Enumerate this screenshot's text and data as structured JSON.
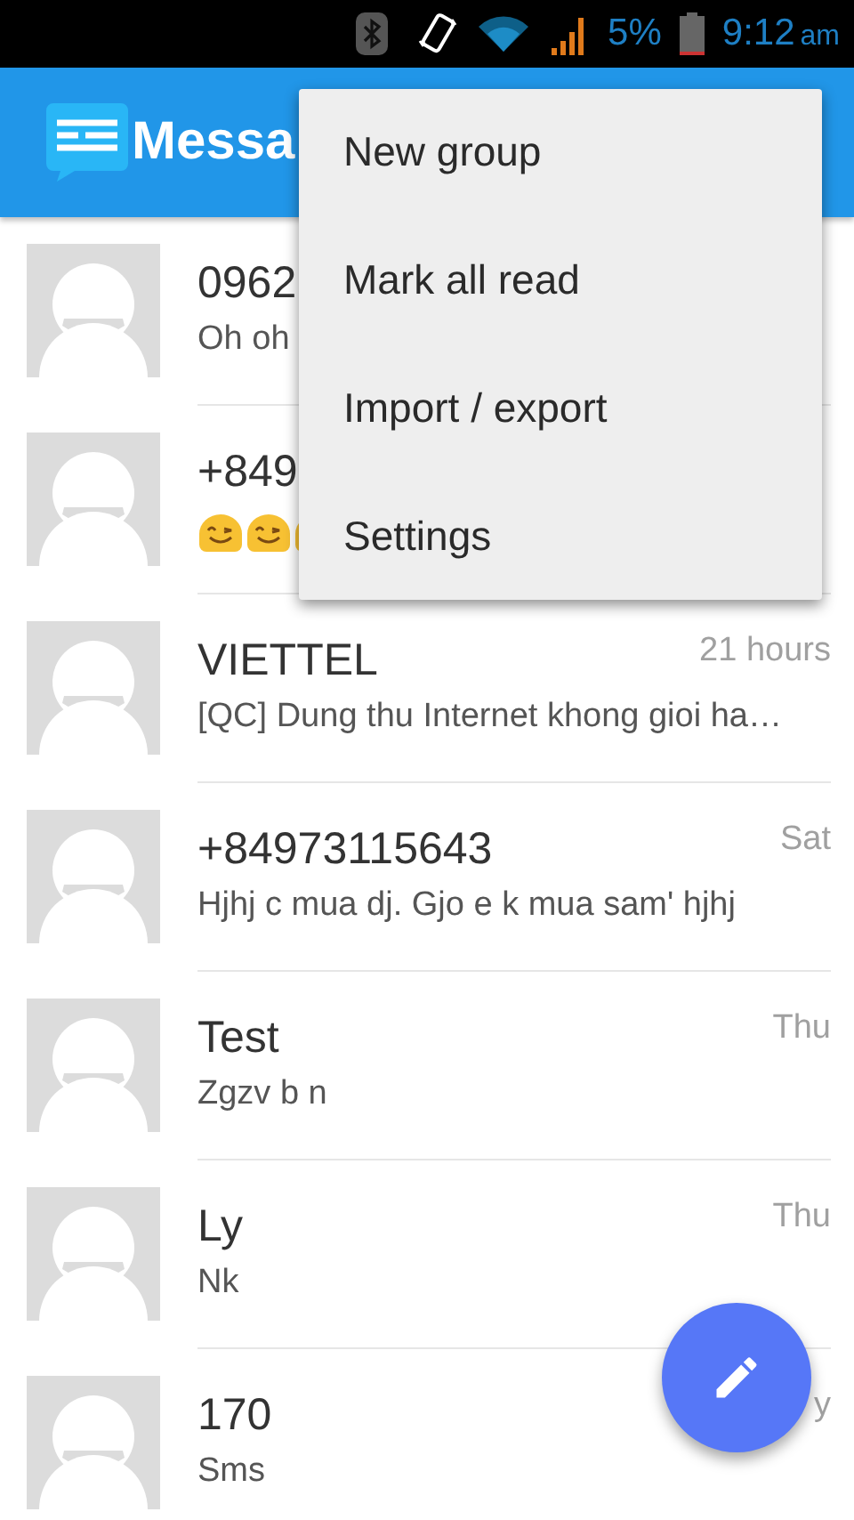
{
  "status_bar": {
    "battery_text": "5%",
    "time": "9:12",
    "ampm": "am"
  },
  "app_bar": {
    "title": "Messa"
  },
  "conversations": [
    {
      "kind": "text",
      "name": "0962",
      "snippet": "Oh oh"
    },
    {
      "kind": "emoji",
      "name": "+849"
    },
    {
      "kind": "text",
      "name": "VIETTEL",
      "time": "21 hours",
      "snippet": "[QC] Dung thu Internet khong gioi ha…"
    },
    {
      "kind": "text",
      "name": "+84973115643",
      "time": "Sat",
      "snippet": "Hjhj c mua dj. Gjo e k mua sam' hjhj"
    },
    {
      "kind": "text",
      "name": "Test",
      "time": "Thu",
      "snippet": "Zgzv b n"
    },
    {
      "kind": "text",
      "name": "Ly",
      "time": "Thu",
      "snippet": "Nk"
    },
    {
      "kind": "text",
      "name": "170",
      "time": "y",
      "snippet": "Sms"
    }
  ],
  "overflow_menu": {
    "items": [
      "New group",
      "Mark all read",
      "Import / export",
      "Settings"
    ]
  }
}
